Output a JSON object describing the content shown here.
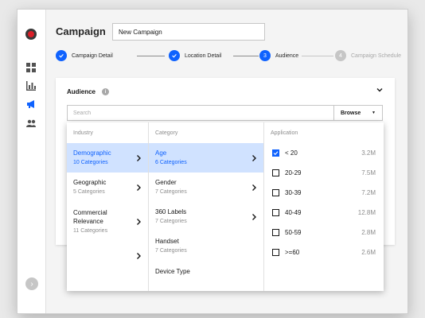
{
  "page": {
    "title": "Campaign",
    "name_value": "New Campaign"
  },
  "sidebar": {
    "items": [
      {
        "icon": "dashboard-icon"
      },
      {
        "icon": "bar-chart-icon"
      },
      {
        "icon": "megaphone-icon"
      },
      {
        "icon": "users-icon"
      }
    ],
    "collapse_icon": "chevron-right-icon"
  },
  "steps": [
    {
      "label": "Campaign Detail",
      "state": "complete"
    },
    {
      "label": "Location Detail",
      "state": "complete"
    },
    {
      "label": "Audience",
      "state": "current",
      "number": "3"
    },
    {
      "label": "Campaign Schedule",
      "state": "future",
      "number": "4"
    }
  ],
  "audience": {
    "title": "Audience",
    "search_placeholder": "Search",
    "browse_label": "Browse"
  },
  "dropdown": {
    "industry_header": "Industry",
    "category_header": "Category",
    "application_header": "Application",
    "industries": [
      {
        "label": "Demographic",
        "sub": "10 Categories",
        "selected": true
      },
      {
        "label": "Geographic",
        "sub": "5 Categories",
        "selected": false
      },
      {
        "label": "Commercial Relevance",
        "sub": "11 Categories",
        "selected": false
      },
      {
        "label": "",
        "sub": "",
        "selected": false
      }
    ],
    "categories": [
      {
        "label": "Age",
        "sub": "6 Categories",
        "selected": true
      },
      {
        "label": "Gender",
        "sub": "7 Categories",
        "selected": false
      },
      {
        "label": "360 Labels",
        "sub": "7 Categories",
        "selected": false
      },
      {
        "label": "Handset",
        "sub": "7 Categories",
        "selected": false
      },
      {
        "label": "Device Type",
        "sub": "",
        "selected": false
      }
    ],
    "applications": [
      {
        "label": "< 20",
        "count": "3.2M",
        "checked": true
      },
      {
        "label": "20-29",
        "count": "7.5M",
        "checked": false
      },
      {
        "label": "30-39",
        "count": "7.2M",
        "checked": false
      },
      {
        "label": "40-49",
        "count": "12.8M",
        "checked": false
      },
      {
        "label": "50-59",
        "count": "2.8M",
        "checked": false
      },
      {
        "label": ">=60",
        "count": "2.6M",
        "checked": false
      }
    ]
  },
  "colors": {
    "accent": "#0f62fe",
    "selected_bg": "#d0e2ff",
    "muted_text": "#8d8d8d"
  }
}
